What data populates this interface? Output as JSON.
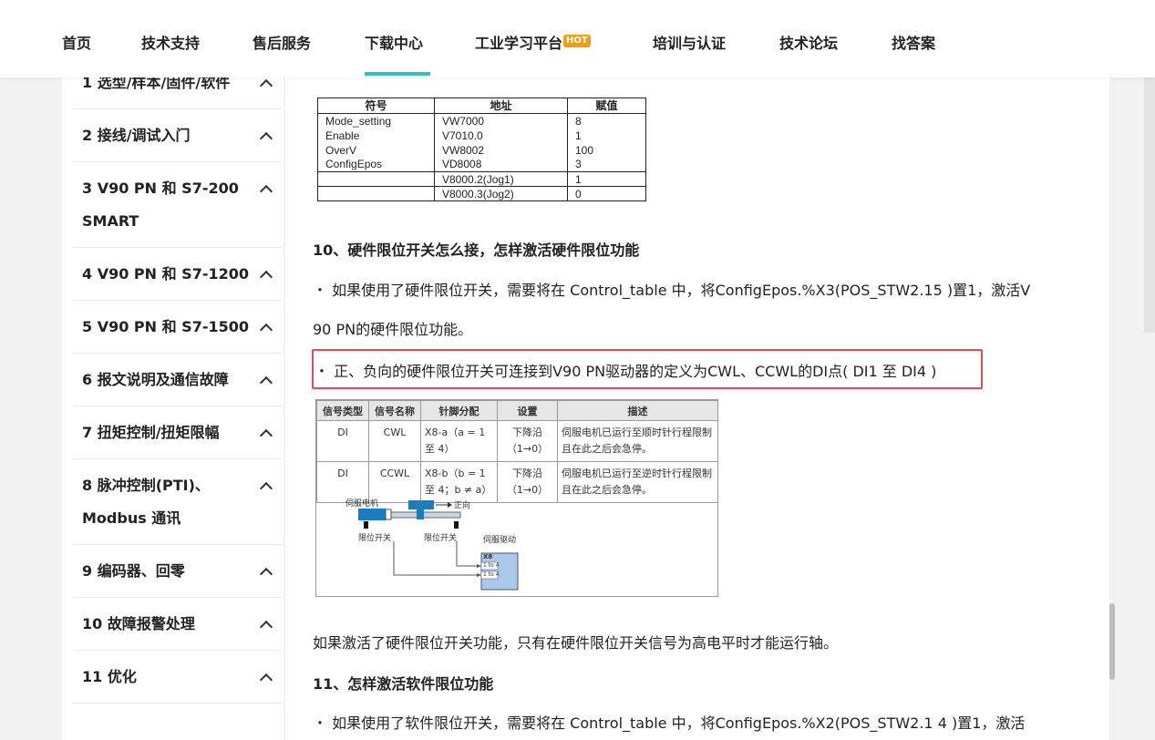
{
  "nav": {
    "items": [
      "首页",
      "技术支持",
      "售后服务",
      "下载中心",
      "工业学习平台",
      "培训与认证",
      "技术论坛",
      "找答案"
    ],
    "hot_badge": "HOT",
    "active_index": 3,
    "accent_color": "#2bc3c3"
  },
  "sidebar": {
    "items": [
      {
        "label": "1 选型/样本/固件/软件"
      },
      {
        "label": "2 接线/调试入门"
      },
      {
        "label": "3 V90 PN 和 S7-200 SMART"
      },
      {
        "label": "4 V90 PN 和 S7-1200"
      },
      {
        "label": "5 V90 PN 和 S7-1500"
      },
      {
        "label": "6 报文说明及通信故障"
      },
      {
        "label": "7 扭矩控制/扭矩限幅"
      },
      {
        "label": "8 脉冲控制(PTI)、Modbus 通讯"
      },
      {
        "label": "9 编码器、回零"
      },
      {
        "label": "10 故障报警处理"
      },
      {
        "label": "11 优化"
      }
    ]
  },
  "table1": {
    "headers": [
      "符号",
      "地址",
      "赋值"
    ],
    "rows": [
      [
        "Mode_setting",
        "VW7000",
        "8"
      ],
      [
        "Enable",
        "V7010.0",
        "1"
      ],
      [
        "OverV",
        "VW8002",
        "100"
      ],
      [
        "ConfigEpos",
        "VD8008",
        "3"
      ],
      [
        "",
        "V8000.2(Jog1)",
        "1"
      ],
      [
        "",
        "V8000.3(Jog2)",
        "0"
      ]
    ]
  },
  "content": {
    "heading10": "10、硬件限位开关怎么接，怎样激活硬件限位功能",
    "p1_line1": "・ 如果使用了硬件限位开关，需要将在 Control_table 中，将ConfigEpos.%X3(POS_STW2.15 )置1，激活V",
    "p1_line2": "90 PN的硬件限位功能。",
    "p2": "・ 正、负向的硬件限位开关可连接到V90 PN驱动器的定义为CWL、CCWL的DI点( DI1 至 DI4 )",
    "p3": "如果激活了硬件限位开关功能，只有在硬件限位开关信号为高电平时才能运行轴。",
    "heading11": "11、怎样激活软件限位功能",
    "p4": "・ 如果使用了软件限位开关，需要将在 Control_table 中，将ConfigEpos.%X2(POS_STW2.1 4 )置1，激活",
    "highlight_color": "#e74a4a"
  },
  "table2": {
    "headers": [
      "信号类型",
      "信号名称",
      "针脚分配",
      "设置",
      "描述"
    ],
    "rows": [
      [
        "DI",
        "CWL",
        "X8-a（a = 1 至 4）",
        "下降沿 （1→0）",
        "伺服电机已运行至顺时针行程限制且在此之后会急停。"
      ],
      [
        "DI",
        "CCWL",
        "X8-b（b = 1 至 4；b ≠ a）",
        "下降沿 （1→0）",
        "伺服电机已运行至逆时针行程限制且在此之后会急停。"
      ]
    ]
  },
  "diagram": {
    "motor_label": "伺服电机",
    "direction_label": "正向",
    "limit_switch_label": "限位开关",
    "drive_label": "伺服驱动",
    "connector_label": "X8",
    "pin_label": "1 to 4"
  }
}
